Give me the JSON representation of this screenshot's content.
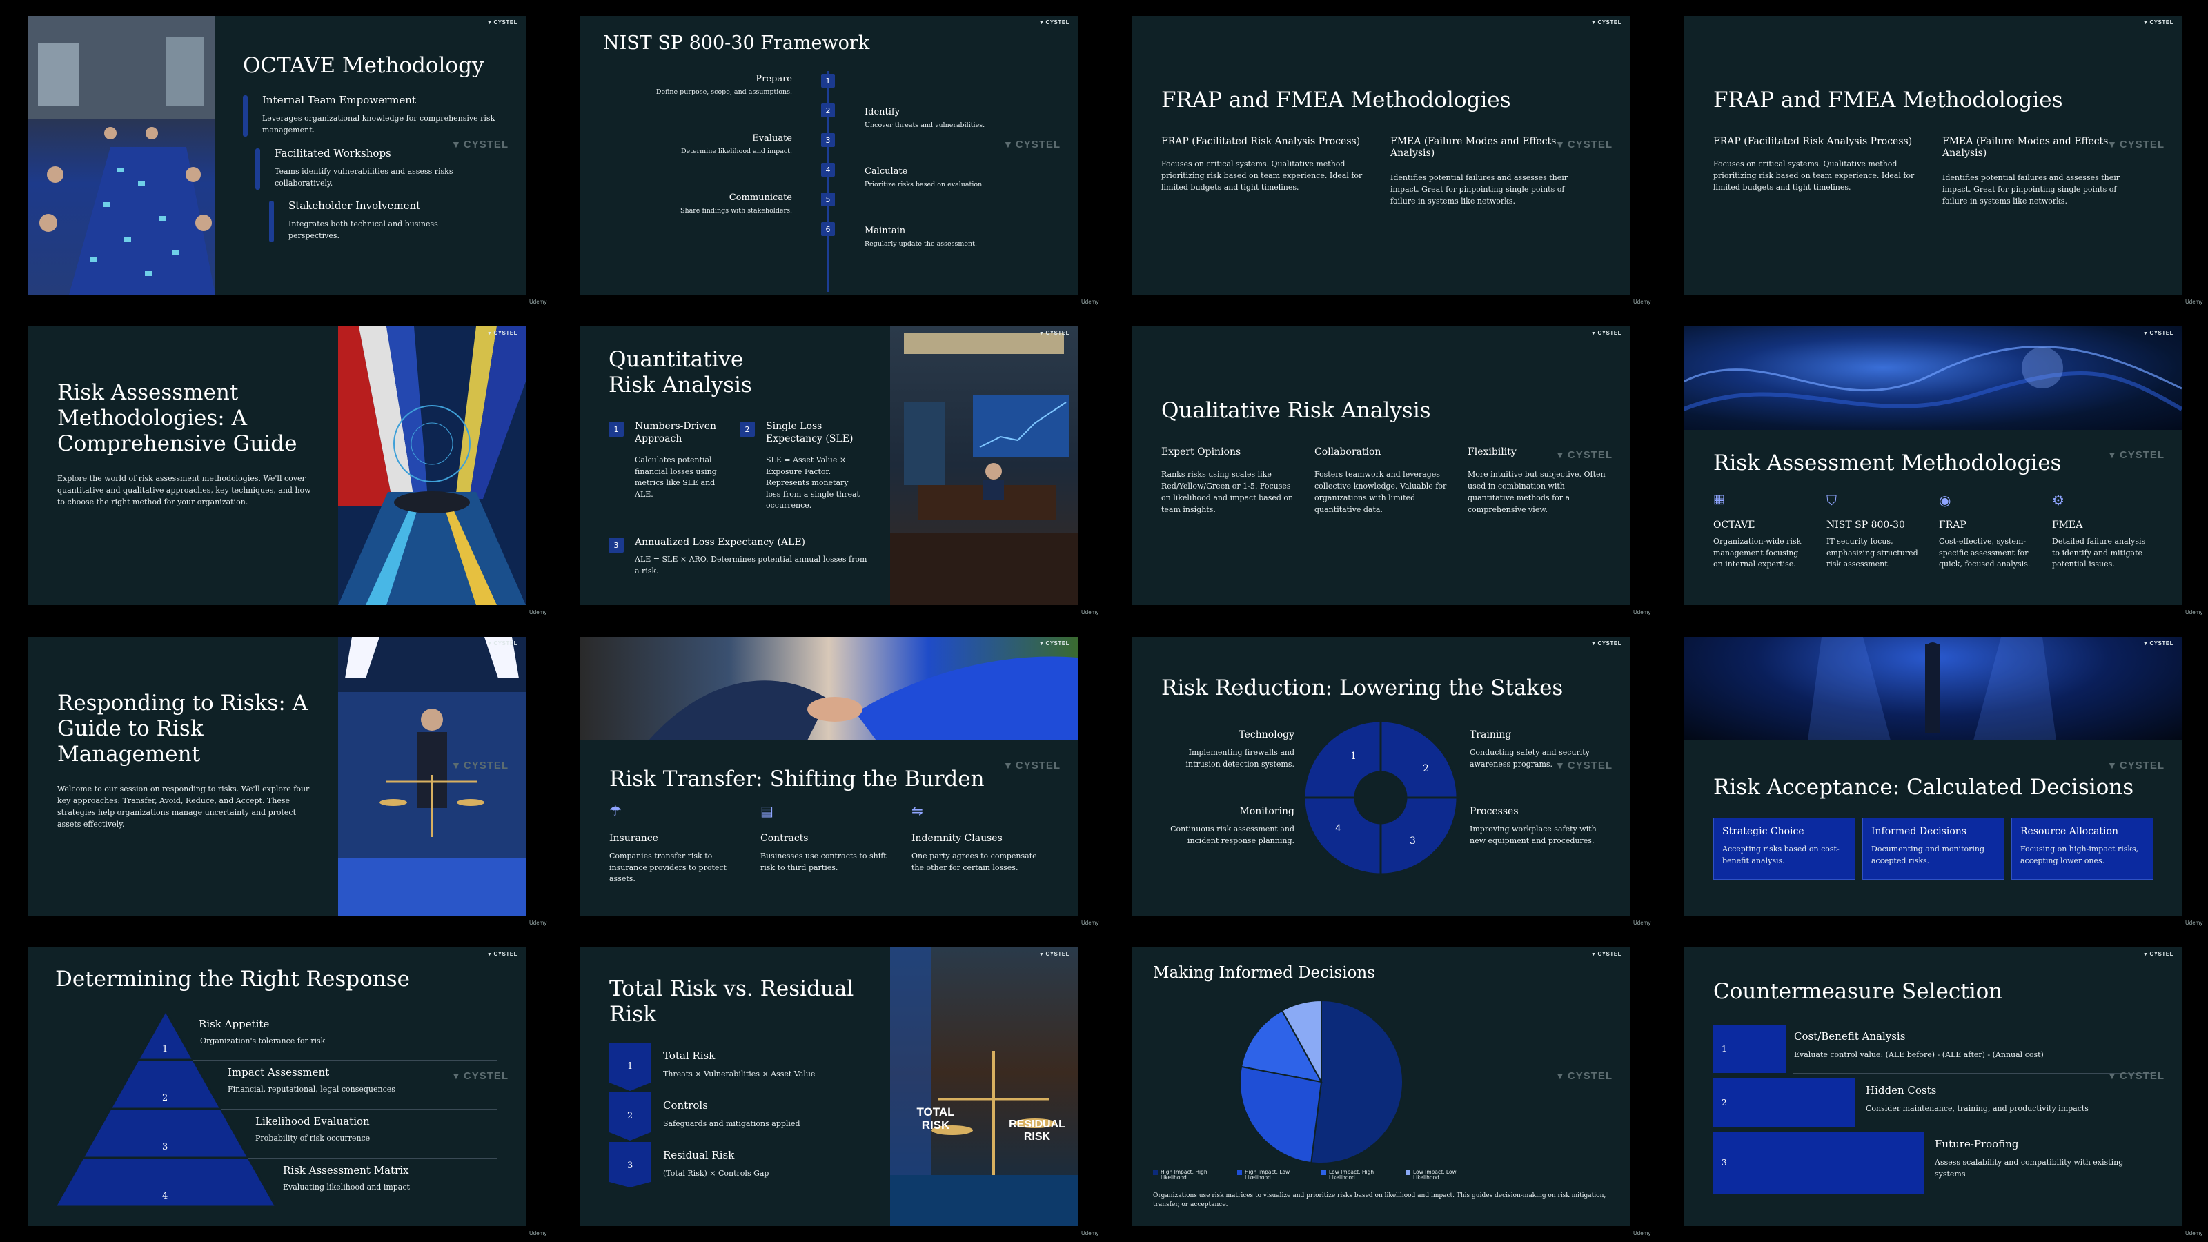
{
  "brand": "CYSTEL",
  "footer": "Udemy",
  "s1": {
    "title": "OCTAVE Methodology",
    "items": [
      {
        "h": "Internal Team Empowerment",
        "d": "Leverages organizational knowledge for comprehensive risk management."
      },
      {
        "h": "Facilitated Workshops",
        "d": "Teams identify vulnerabilities and assess risks collaboratively."
      },
      {
        "h": "Stakeholder Involvement",
        "d": "Integrates both technical and business perspectives."
      }
    ]
  },
  "s2": {
    "title": "NIST SP 800-30 Framework",
    "left": [
      {
        "n": "1",
        "h": "Prepare",
        "d": "Define purpose, scope, and assumptions."
      },
      {
        "n": "3",
        "h": "Evaluate",
        "d": "Determine likelihood and impact."
      },
      {
        "n": "5",
        "h": "Communicate",
        "d": "Share findings with stakeholders."
      }
    ],
    "right": [
      {
        "n": "2",
        "h": "Identify",
        "d": "Uncover threats and vulnerabilities."
      },
      {
        "n": "4",
        "h": "Calculate",
        "d": "Prioritize risks based on evaluation."
      },
      {
        "n": "6",
        "h": "Maintain",
        "d": "Regularly update the assessment."
      }
    ]
  },
  "s3": {
    "title": "FRAP and FMEA Methodologies",
    "c1h": "FRAP (Facilitated Risk Analysis Process)",
    "c1d": "Focuses on critical systems. Qualitative method prioritizing risk based on team experience. Ideal for limited budgets and tight timelines.",
    "c2h": "FMEA (Failure Modes and Effects Analysis)",
    "c2d": "Identifies potential failures and assesses their impact. Great for pinpointing single points of failure in systems like networks."
  },
  "s5": {
    "title": "Risk Assessment Methodologies: A Comprehensive Guide",
    "desc": "Explore the world of risk assessment methodologies. We'll cover quantitative and qualitative approaches, key techniques, and how to choose the right method for your organization."
  },
  "s6": {
    "title": "Quantitative Risk Analysis",
    "i1h": "Numbers-Driven Approach",
    "i1d": "Calculates potential financial losses using metrics like SLE and ALE.",
    "i2h": "Single Loss Expectancy (SLE)",
    "i2d": "SLE = Asset Value × Exposure Factor. Represents monetary loss from a single threat occurrence.",
    "i3h": "Annualized Loss Expectancy (ALE)",
    "i3d": "ALE = SLE × ARO. Determines potential annual losses from a risk.",
    "n1": "1",
    "n2": "2",
    "n3": "3"
  },
  "s7": {
    "title": "Qualitative Risk Analysis",
    "cols": [
      {
        "h": "Expert Opinions",
        "d": "Ranks risks using scales like Red/Yellow/Green or 1-5. Focuses on likelihood and impact based on team insights."
      },
      {
        "h": "Collaboration",
        "d": "Fosters teamwork and leverages collective knowledge. Valuable for organizations with limited quantitative data."
      },
      {
        "h": "Flexibility",
        "d": "More intuitive but subjective. Often used in combination with quantitative methods for a comprehensive view."
      }
    ]
  },
  "s8": {
    "title": "Risk Assessment Methodologies",
    "cols": [
      {
        "h": "OCTAVE",
        "d": "Organization-wide risk management focusing on internal expertise."
      },
      {
        "h": "NIST SP 800-30",
        "d": "IT security focus, emphasizing structured risk assessment."
      },
      {
        "h": "FRAP",
        "d": "Cost-effective, system-specific assessment for quick, focused analysis."
      },
      {
        "h": "FMEA",
        "d": "Detailed failure analysis to identify and mitigate potential issues."
      }
    ]
  },
  "s9": {
    "title": "Responding to Risks: A Guide to Risk Management",
    "desc": "Welcome to our session on responding to risks. We'll explore four key approaches: Transfer, Avoid, Reduce, and Accept. These strategies help organizations manage uncertainty and protect assets effectively."
  },
  "s10": {
    "title": "Risk Transfer: Shifting the Burden",
    "cols": [
      {
        "h": "Insurance",
        "d": "Companies transfer risk to insurance providers to protect assets."
      },
      {
        "h": "Contracts",
        "d": "Businesses use contracts to shift risk to third parties."
      },
      {
        "h": "Indemnity Clauses",
        "d": "One party agrees to compensate the other for certain losses."
      }
    ]
  },
  "s11": {
    "title": "Risk Reduction: Lowering the Stakes",
    "tl": {
      "h": "Technology",
      "d": "Implementing firewalls and intrusion detection systems."
    },
    "tr": {
      "h": "Training",
      "d": "Conducting safety and security awareness programs."
    },
    "bl": {
      "h": "Monitoring",
      "d": "Continuous risk assessment and incident response planning."
    },
    "br": {
      "h": "Processes",
      "d": "Improving workplace safety with new equipment and procedures."
    },
    "n": [
      "1",
      "2",
      "3",
      "4"
    ]
  },
  "s12": {
    "title": "Risk Acceptance: Calculated Decisions",
    "boxes": [
      {
        "h": "Strategic Choice",
        "d": "Accepting risks based on cost-benefit analysis."
      },
      {
        "h": "Informed Decisions",
        "d": "Documenting and monitoring accepted risks."
      },
      {
        "h": "Resource Allocation",
        "d": "Focusing on high-impact risks, accepting lower ones."
      }
    ]
  },
  "s13": {
    "title": "Determining the Right Response",
    "levels": [
      {
        "n": "1",
        "h": "Risk Appetite",
        "d": "Organization's tolerance for risk"
      },
      {
        "n": "2",
        "h": "Impact Assessment",
        "d": "Financial, reputational, legal consequences"
      },
      {
        "n": "3",
        "h": "Likelihood Evaluation",
        "d": "Probability of risk occurrence"
      },
      {
        "n": "4",
        "h": "Risk Assessment Matrix",
        "d": "Evaluating likelihood and impact"
      }
    ]
  },
  "s14": {
    "title": "Total Risk vs. Residual Risk",
    "items": [
      {
        "n": "1",
        "h": "Total Risk",
        "d": "Threats × Vulnerabilities × Asset Value"
      },
      {
        "n": "2",
        "h": "Controls",
        "d": "Safeguards and mitigations applied"
      },
      {
        "n": "3",
        "h": "Residual Risk",
        "d": "(Total Risk) × Controls Gap"
      }
    ],
    "img_l": "TOTAL RISK",
    "img_r": "RESIDUAL RISK"
  },
  "s15": {
    "title": "Making Informed Decisions",
    "caption": "Organizations use risk matrices to visualize and prioritize risks based on likelihood and impact. This guides decision-making on risk mitigation, transfer, or acceptance.",
    "colors": [
      "#0b2a7a",
      "#1f4fd6",
      "#2e63e8",
      "#8aaaf5"
    ],
    "chart_data": {
      "type": "pie",
      "categories": [
        "High Impact, High Likelihood",
        "High Impact, Low Likelihood",
        "Low Impact, High Likelihood",
        "Low Impact, Low Likelihood"
      ],
      "values": [
        52,
        26,
        14,
        8
      ]
    }
  },
  "s16": {
    "title": "Countermeasure Selection",
    "items": [
      {
        "n": "1",
        "h": "Cost/Benefit Analysis",
        "d": "Evaluate control value: (ALE before) - (ALE after) - (Annual cost)"
      },
      {
        "n": "2",
        "h": "Hidden Costs",
        "d": "Consider maintenance, training, and productivity impacts"
      },
      {
        "n": "3",
        "h": "Future-Proofing",
        "d": "Assess scalability and compatibility with existing systems"
      }
    ]
  }
}
